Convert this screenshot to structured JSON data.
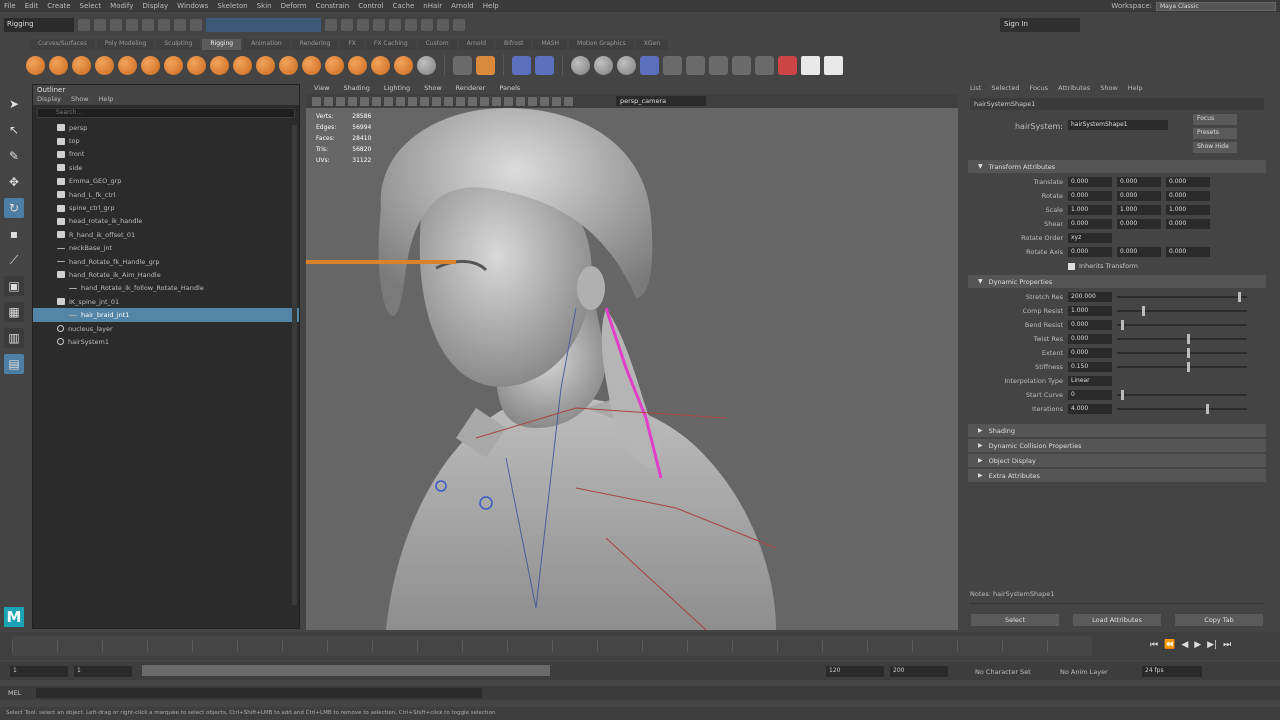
{
  "outliner": {
    "title": "Outliner",
    "menus": [
      "Display",
      "Show",
      "Help"
    ],
    "search_placeholder": "Search...",
    "rows": [
      {
        "label": "persp",
        "icon": "camera",
        "indent": 1
      },
      {
        "label": "top",
        "icon": "camera",
        "indent": 1
      },
      {
        "label": "front",
        "icon": "camera",
        "indent": 1
      },
      {
        "label": "side",
        "icon": "camera",
        "indent": 1
      },
      {
        "label": "Emma_GEO_grp",
        "icon": "group",
        "indent": 1
      },
      {
        "label": "hand_L_fk_ctrl",
        "icon": "group",
        "indent": 1
      },
      {
        "label": "spine_ctrl_grp",
        "icon": "group",
        "indent": 1
      },
      {
        "label": "head_rotate_ik_handle",
        "icon": "group",
        "indent": 1
      },
      {
        "label": "R_hand_ik_offset_01",
        "icon": "group",
        "indent": 1
      },
      {
        "label": "neckBase_jnt",
        "icon": "dash",
        "indent": 1
      },
      {
        "label": "hand_Rotate_fk_Handle_grp",
        "icon": "dash",
        "indent": 1
      },
      {
        "label": "hand_Rotate_ik_Aim_Handle",
        "icon": "group",
        "indent": 1
      },
      {
        "label": "hand_Rotate_ik_follow_Rotate_Handle",
        "icon": "dash",
        "indent": 2
      },
      {
        "label": "IK_spine_jnt_01",
        "icon": "group",
        "indent": 1
      },
      {
        "label": "hair_braid_jnt1",
        "icon": "dash",
        "indent": 2,
        "selected": true
      },
      {
        "label": "nucleus_layer",
        "icon": "joint",
        "indent": 1
      },
      {
        "label": "hairSystem1",
        "icon": "joint",
        "indent": 1
      }
    ]
  },
  "viewport": {
    "menus": [
      "View",
      "Shading",
      "Lighting",
      "Show",
      "Renderer",
      "Panels"
    ],
    "camera": "persp_camera",
    "hud": [
      {
        "label": "Verts:",
        "value": "28586"
      },
      {
        "label": "Edges:",
        "value": "56994"
      },
      {
        "label": "Faces:",
        "value": "28410"
      },
      {
        "label": "Tris:",
        "value": "56820"
      },
      {
        "label": "UVs:",
        "value": "31122"
      }
    ]
  },
  "attribute_editor": {
    "tabs": [
      "List",
      "Selected",
      "Focus",
      "Attributes",
      "Show",
      "Help"
    ],
    "node_tab": "hairSystemShape1",
    "node_label": "hairSystem:",
    "node_value": "hairSystemShape1",
    "buttons_side": [
      "Focus",
      "Presets",
      "Show Hide"
    ],
    "sections": {
      "transform": "Transform Attributes",
      "dynamics": "Dynamic Properties",
      "collapsed": [
        "Shading",
        "Dynamic Collision Properties",
        "Object Display",
        "Extra Attributes"
      ]
    },
    "transform_rows": [
      {
        "label": "Translate",
        "values": [
          "0.000",
          "0.000",
          "0.000"
        ]
      },
      {
        "label": "Rotate",
        "values": [
          "0.000",
          "0.000",
          "0.000"
        ]
      },
      {
        "label": "Scale",
        "values": [
          "1.000",
          "1.000",
          "1.000"
        ]
      },
      {
        "label": "Shear",
        "values": [
          "0.000",
          "0.000",
          "0.000"
        ]
      }
    ],
    "rotate_order_label": "Rotate Order",
    "rotate_order": "xyz",
    "rotate_axis_label": "Rotate Axis",
    "rotate_axis": [
      "0.000",
      "0.000",
      "0.000"
    ],
    "inherits_label": "Inherits Transform",
    "dynamic_rows": [
      {
        "label": "Stretch Res",
        "value": "200.000",
        "level": 0.95
      },
      {
        "label": "Comp Resist",
        "value": "1.000",
        "level": 0.2
      },
      {
        "label": "Bend Resist",
        "value": "0.000",
        "level": 0.03
      },
      {
        "label": "Twist Res",
        "value": "0.000",
        "level": 0.55
      },
      {
        "label": "Extent",
        "value": "0.000",
        "level": 0.55
      },
      {
        "label": "Stiffness",
        "value": "0.150",
        "level": 0.55
      }
    ],
    "interp_label": "Interpolation Type",
    "interp_value": "Linear",
    "start_label": "Start Curve",
    "start_value": "0",
    "start_level": 0.03,
    "iter_label": "Iterations",
    "iter_value": "4.000",
    "iter_level": 0.7,
    "notes_label": "Notes: hairSystemShape1",
    "bottom_buttons": [
      "Select",
      "Load Attributes",
      "Copy Tab"
    ]
  },
  "timeline": {
    "start": "1",
    "end": "120",
    "range_start": "1",
    "range_end": "120",
    "anim_end": "200",
    "current_fps": "24 fps",
    "char_set": "No Character Set",
    "anim_layer": "No Anim Layer"
  },
  "command_line": {
    "label": "MEL",
    "help": "Select Tool: select an object. Left-drag or right-click a marquee to select objects, Ctrl+Shift+LMB to add and Ctrl+LMB to remove to selection, Ctrl+Shift+click to toggle selection"
  },
  "menubar": {
    "items": [
      "File",
      "Edit",
      "Create",
      "Select",
      "Modify",
      "Display",
      "Windows",
      "Skeleton",
      "Skin",
      "Deform",
      "Constrain",
      "Control",
      "Cache",
      "nHair",
      "Arnold",
      "Help"
    ],
    "workspace_label": "Workspace:",
    "workspace_value": "Maya Classic"
  },
  "statusline": {
    "mode": "Rigging",
    "user": "Sign In"
  },
  "shelf_tabs": [
    "Curves/Surfaces",
    "Poly Modeling",
    "Sculpting",
    "Rigging",
    "Animation",
    "Rendering",
    "FX",
    "FX Caching",
    "Custom",
    "Arnold",
    "Bifrost",
    "MASH",
    "Motion Graphics",
    "XGen"
  ],
  "colors": {
    "accent": "#5285a6",
    "brand": "#1ba3b6",
    "joint_highlight": "#e040c8",
    "shelf_icon": "#e8832e"
  }
}
